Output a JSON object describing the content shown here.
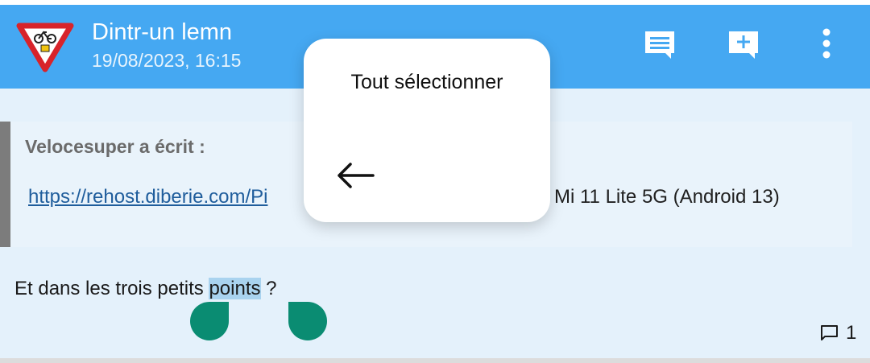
{
  "colors": {
    "header_bg": "#45a8f2",
    "page_bg": "#e4f1fb",
    "quote_bar": "#7c7c7c",
    "link": "#1f5d9c",
    "selection": "#a9d3ef",
    "handle": "#0a8c72"
  },
  "header": {
    "logo_icon": "bicycle-warning-sign-icon",
    "title": "Dintr-un lemn",
    "date": "19/08/2023, 16:15",
    "actions": [
      {
        "icon": "chat-icon"
      },
      {
        "icon": "new-message-icon"
      },
      {
        "icon": "more-vert-icon"
      }
    ]
  },
  "quote": {
    "author": "Velocesuper a écrit :",
    "link": "https://rehost.diberie.com/Pi",
    "device": "i Mi 11 Lite 5G (Android 13)"
  },
  "post": {
    "text_before": "Et dans les trois petits ",
    "selected_text": "points",
    "text_after": " ?",
    "reply_icon": "comment-icon",
    "reply_count": "1"
  },
  "context_menu": {
    "select_all": "Tout sélectionner",
    "back_icon": "arrow-back-icon"
  }
}
